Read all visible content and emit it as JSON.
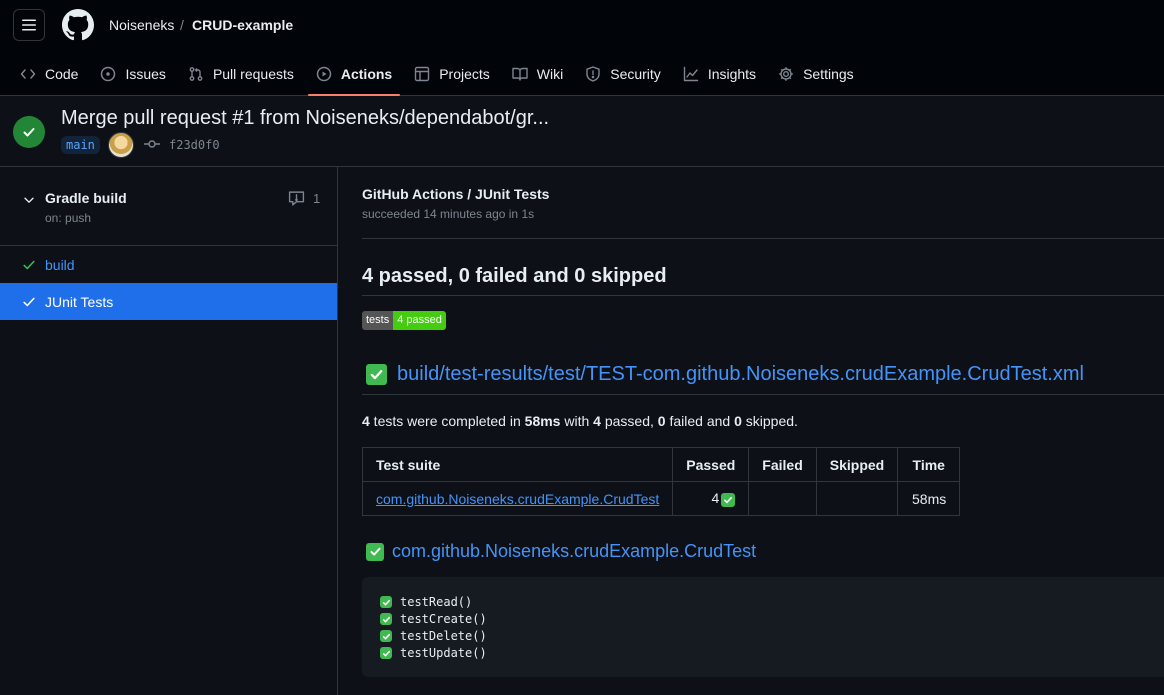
{
  "header": {
    "owner": "Noiseneks",
    "separator": "/",
    "repo": "CRUD-example"
  },
  "nav": [
    {
      "label": "Code",
      "icon": "code-icon"
    },
    {
      "label": "Issues",
      "icon": "issue-opened-icon"
    },
    {
      "label": "Pull requests",
      "icon": "git-pull-request-icon"
    },
    {
      "label": "Actions",
      "icon": "play-icon",
      "active": true
    },
    {
      "label": "Projects",
      "icon": "table-icon"
    },
    {
      "label": "Wiki",
      "icon": "book-icon"
    },
    {
      "label": "Security",
      "icon": "shield-icon"
    },
    {
      "label": "Insights",
      "icon": "graph-icon"
    },
    {
      "label": "Settings",
      "icon": "gear-icon"
    }
  ],
  "run": {
    "title": "Merge pull request #1 from Noiseneks/dependabot/gr...",
    "branch": "main",
    "sha": "f23d0f0",
    "status": "success"
  },
  "sidebar": {
    "workflow_name": "Gradle build",
    "workflow_trigger": "on: push",
    "annotations_count": "1",
    "jobs": [
      {
        "label": "build",
        "status": "success"
      },
      {
        "label": "JUnit Tests",
        "status": "success",
        "selected": true
      }
    ]
  },
  "check": {
    "title": "GitHub Actions / JUnit Tests",
    "subtitle": "succeeded 14 minutes ago in 1s",
    "summary": "4 passed, 0 failed and 0 skipped",
    "badge_left": "tests",
    "badge_right": "4 passed",
    "file_heading": "build/test-results/test/TEST-com.github.Noiseneks.crudExample.CrudTest.xml",
    "desc": {
      "count": "4",
      "t1": " tests were completed in ",
      "time": "58ms",
      "t2": " with ",
      "passed": "4",
      "t3": " passed, ",
      "failed": "0",
      "t4": " failed and ",
      "skipped": "0",
      "t5": " skipped."
    },
    "table": {
      "headers": [
        "Test suite",
        "Passed",
        "Failed",
        "Skipped",
        "Time"
      ],
      "rows": [
        {
          "suite": "com.github.Noiseneks.crudExample.CrudTest",
          "passed": "4",
          "failed": "",
          "skipped": "",
          "time": "58ms"
        }
      ]
    },
    "suite_heading": "com.github.Noiseneks.crudExample.CrudTest",
    "tests": [
      "testRead()",
      "testCreate()",
      "testDelete()",
      "testUpdate()"
    ]
  },
  "colors": {
    "accent": "#f78166",
    "success": "#238636",
    "link": "#4493f8",
    "selected": "#1f6feb"
  }
}
